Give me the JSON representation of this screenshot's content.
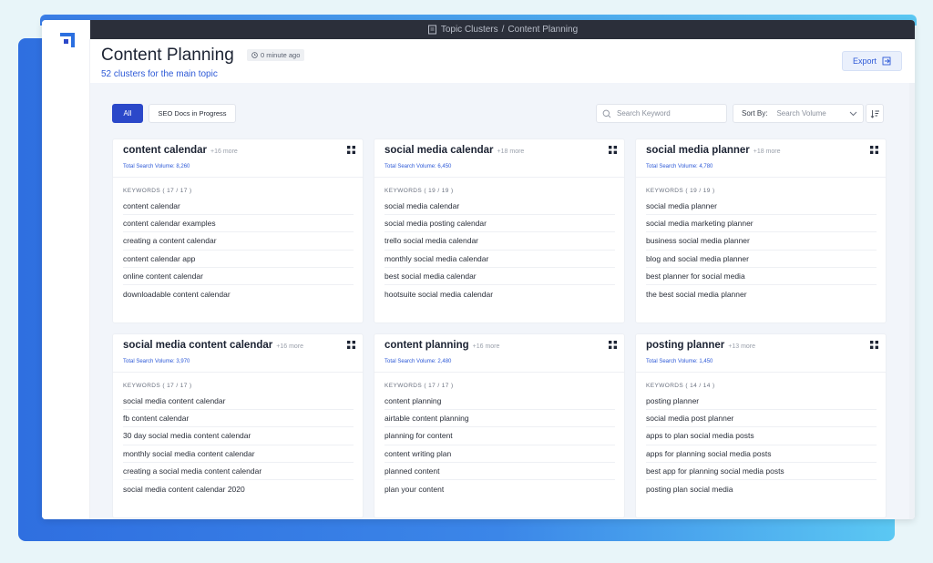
{
  "breadcrumb": {
    "parent": "Topic Clusters",
    "separator": "/",
    "current": "Content Planning"
  },
  "header": {
    "title": "Content Planning",
    "updated": "0 minute ago",
    "subtitle": "52 clusters for the main topic",
    "export_label": "Export"
  },
  "filters": {
    "all_label": "All",
    "seo_label": "SEO Docs in Progress"
  },
  "search": {
    "placeholder": "Search Keyword",
    "value": ""
  },
  "sort": {
    "label": "Sort By:",
    "value": "Search Volume"
  },
  "icons": {
    "logo": "app-logo-icon",
    "breadcrumb": "document-icon",
    "time": "clock-icon",
    "export": "export-icon",
    "search": "search-icon",
    "dropdown": "chevron-down-icon",
    "sort_order": "sort-order-icon",
    "card_menu": "grid-dots-icon"
  },
  "colors": {
    "accent": "#2e5ad7",
    "primary_button": "#2b48c9",
    "topbar": "#2b2f3a"
  },
  "clusters": [
    {
      "title": "content calendar",
      "more": "+16 more",
      "volume": "Total Search Volume: 8,260",
      "keywords_header": "KEYWORDS ( 17 / 17 )",
      "keywords": [
        "content calendar",
        "content calendar examples",
        "creating a content calendar",
        "content calendar app",
        "online content calendar",
        "downloadable content calendar"
      ]
    },
    {
      "title": "social media calendar",
      "more": "+18 more",
      "volume": "Total Search Volume: 6,450",
      "keywords_header": "KEYWORDS ( 19 / 19 )",
      "keywords": [
        "social media calendar",
        "social media posting calendar",
        "trello social media calendar",
        "monthly social media calendar",
        "best social media calendar",
        "hootsuite social media calendar"
      ]
    },
    {
      "title": "social media planner",
      "more": "+18 more",
      "volume": "Total Search Volume: 4,780",
      "keywords_header": "KEYWORDS ( 19 / 19 )",
      "keywords": [
        "social media planner",
        "social media marketing planner",
        "business social media planner",
        "blog and social media planner",
        "best planner for social media",
        "the best social media planner"
      ]
    },
    {
      "title": "social media content calendar",
      "more": "+16 more",
      "volume": "Total Search Volume: 3,970",
      "keywords_header": "KEYWORDS ( 17 / 17 )",
      "keywords": [
        "social media content calendar",
        "fb content calendar",
        "30 day social media content calendar",
        "monthly social media content calendar",
        "creating a social media content calendar",
        "social media content calendar 2020"
      ]
    },
    {
      "title": "content planning",
      "more": "+16 more",
      "volume": "Total Search Volume: 2,480",
      "keywords_header": "KEYWORDS ( 17 / 17 )",
      "keywords": [
        "content planning",
        "airtable content planning",
        "planning for content",
        "content writing plan",
        "planned content",
        "plan your content"
      ]
    },
    {
      "title": "posting planner",
      "more": "+13 more",
      "volume": "Total Search Volume: 1,450",
      "keywords_header": "KEYWORDS ( 14 / 14 )",
      "keywords": [
        "posting planner",
        "social media post planner",
        "apps to plan social media posts",
        "apps for planning social media posts",
        "best app for planning social media posts",
        "posting plan social media"
      ]
    }
  ]
}
